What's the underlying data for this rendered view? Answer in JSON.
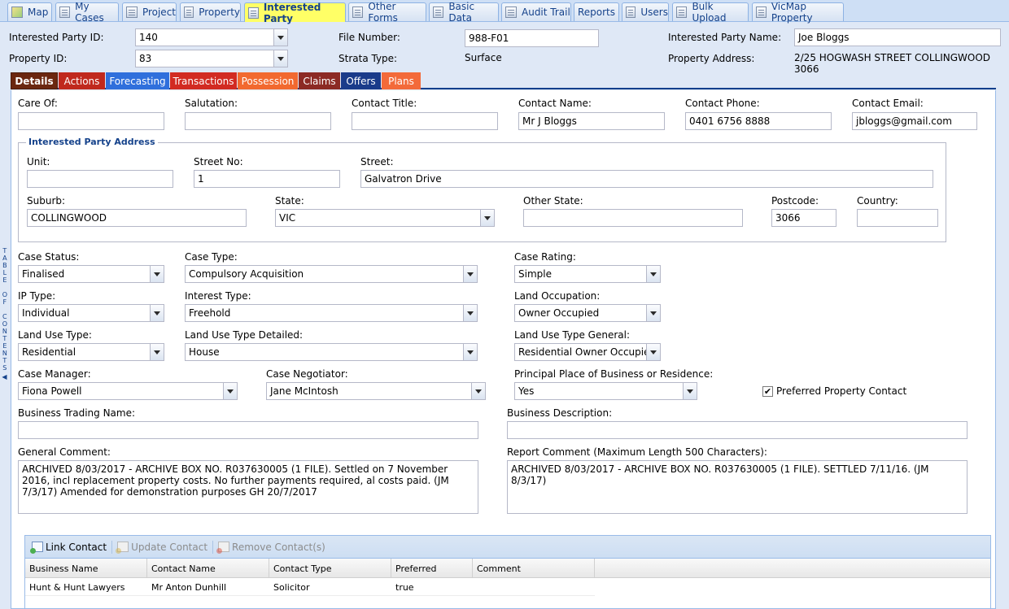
{
  "top_tabs": [
    {
      "label": "Map",
      "icon": "map-icon"
    },
    {
      "label": "My Cases",
      "icon": "form-icon"
    },
    {
      "label": "Project",
      "icon": "form-icon"
    },
    {
      "label": "Property",
      "icon": "form-icon"
    },
    {
      "label": "Interested Party",
      "icon": "form-icon",
      "active": true
    },
    {
      "label": "Other Forms",
      "icon": "form-icon"
    },
    {
      "label": "Basic Data",
      "icon": "form-icon"
    },
    {
      "label": "Audit Trail",
      "icon": "form-icon"
    },
    {
      "label": "Reports",
      "icon": "form-icon"
    },
    {
      "label": "Users",
      "icon": "form-icon"
    },
    {
      "label": "Bulk Upload",
      "icon": "form-icon"
    },
    {
      "label": "VicMap Property",
      "icon": "form-icon"
    }
  ],
  "header": {
    "ip_id_label": "Interested Party ID:",
    "ip_id_value": "140",
    "property_id_label": "Property ID:",
    "property_id_value": "83",
    "file_number_label": "File Number:",
    "file_number_value": "988-F01",
    "strata_type_label": "Strata Type:",
    "strata_type_value": "Surface",
    "ip_name_label": "Interested Party Name:",
    "ip_name_value": "Joe Bloggs",
    "property_address_label": "Property Address:",
    "property_address_value": "2/25 HOGWASH STREET COLLINGWOOD 3066"
  },
  "section_tabs": [
    {
      "label": "Details",
      "color": "#6b2710",
      "active": true
    },
    {
      "label": "Actions",
      "color": "#c0291d"
    },
    {
      "label": "Forecasting",
      "color": "#2f6fdc"
    },
    {
      "label": "Transactions",
      "color": "#d22b22"
    },
    {
      "label": "Possession",
      "color": "#f2692f"
    },
    {
      "label": "Claims",
      "color": "#8c2a24"
    },
    {
      "label": "Offers",
      "color": "#1a3b8a"
    },
    {
      "label": "Plans",
      "color": "#f36a3a"
    }
  ],
  "contact": {
    "care_of_label": "Care Of:",
    "care_of_value": "",
    "salutation_label": "Salutation:",
    "salutation_value": "",
    "contact_title_label": "Contact Title:",
    "contact_title_value": "",
    "contact_name_label": "Contact Name:",
    "contact_name_value": "Mr J Bloggs",
    "contact_phone_label": "Contact Phone:",
    "contact_phone_value": "0401 6756 8888",
    "contact_email_label": "Contact Email:",
    "contact_email_value": "jbloggs@gmail.com"
  },
  "address": {
    "legend": "Interested Party Address",
    "unit_label": "Unit:",
    "unit_value": "",
    "street_no_label": "Street No:",
    "street_no_value": "1",
    "street_label": "Street:",
    "street_value": "Galvatron Drive",
    "suburb_label": "Suburb:",
    "suburb_value": "COLLINGWOOD",
    "state_label": "State:",
    "state_value": "VIC",
    "other_state_label": "Other State:",
    "other_state_value": "",
    "postcode_label": "Postcode:",
    "postcode_value": "3066",
    "country_label": "Country:",
    "country_value": ""
  },
  "case": {
    "case_status_label": "Case Status:",
    "case_status_value": "Finalised",
    "case_type_label": "Case Type:",
    "case_type_value": "Compulsory Acquisition",
    "case_rating_label": "Case Rating:",
    "case_rating_value": "Simple",
    "ip_type_label": "IP Type:",
    "ip_type_value": "Individual",
    "interest_type_label": "Interest Type:",
    "interest_type_value": "Freehold",
    "land_occupation_label": "Land Occupation:",
    "land_occupation_value": "Owner Occupied",
    "land_use_type_label": "Land Use Type:",
    "land_use_type_value": "Residential",
    "land_use_detailed_label": "Land Use Type Detailed:",
    "land_use_detailed_value": "House",
    "land_use_general_label": "Land Use Type General:",
    "land_use_general_value": "Residential Owner Occupied",
    "case_manager_label": "Case Manager:",
    "case_manager_value": "Fiona Powell",
    "case_negotiator_label": "Case Negotiator:",
    "case_negotiator_value": "Jane McIntosh",
    "principal_place_label": "Principal Place of Business or Residence:",
    "principal_place_value": "Yes",
    "preferred_contact_label": "Preferred Property Contact",
    "preferred_contact_checked": true,
    "business_trading_label": "Business Trading Name:",
    "business_trading_value": "",
    "business_description_label": "Business Description:",
    "business_description_value": "",
    "general_comment_label": "General Comment:",
    "general_comment_value": "ARCHIVED 8/03/2017 - ARCHIVE BOX NO. R037630005 (1 FILE). Settled on 7 November 2016, incl replacement property costs. No further payments required, al costs paid. (JM 7/3/17)  Amended for demonstration purposes GH 20/7/2017",
    "report_comment_label": "Report Comment (Maximum Length 500 Characters):",
    "report_comment_value": "ARCHIVED 8/03/2017 - ARCHIVE BOX NO. R037630005 (1 FILE). SETTLED 7/11/16. (JM 8/3/17)"
  },
  "toc_strip": "TABLE OF CONTENTS",
  "grid": {
    "toolbar": {
      "link_label": "Link Contact",
      "update_label": "Update Contact",
      "remove_label": "Remove Contact(s)"
    },
    "columns": [
      "Business Name",
      "Contact Name",
      "Contact Type",
      "Preferred",
      "Comment"
    ],
    "rows": [
      [
        "Hunt & Hunt Lawyers",
        "Mr Anton Dunhill",
        "Solicitor",
        "true",
        ""
      ]
    ]
  }
}
